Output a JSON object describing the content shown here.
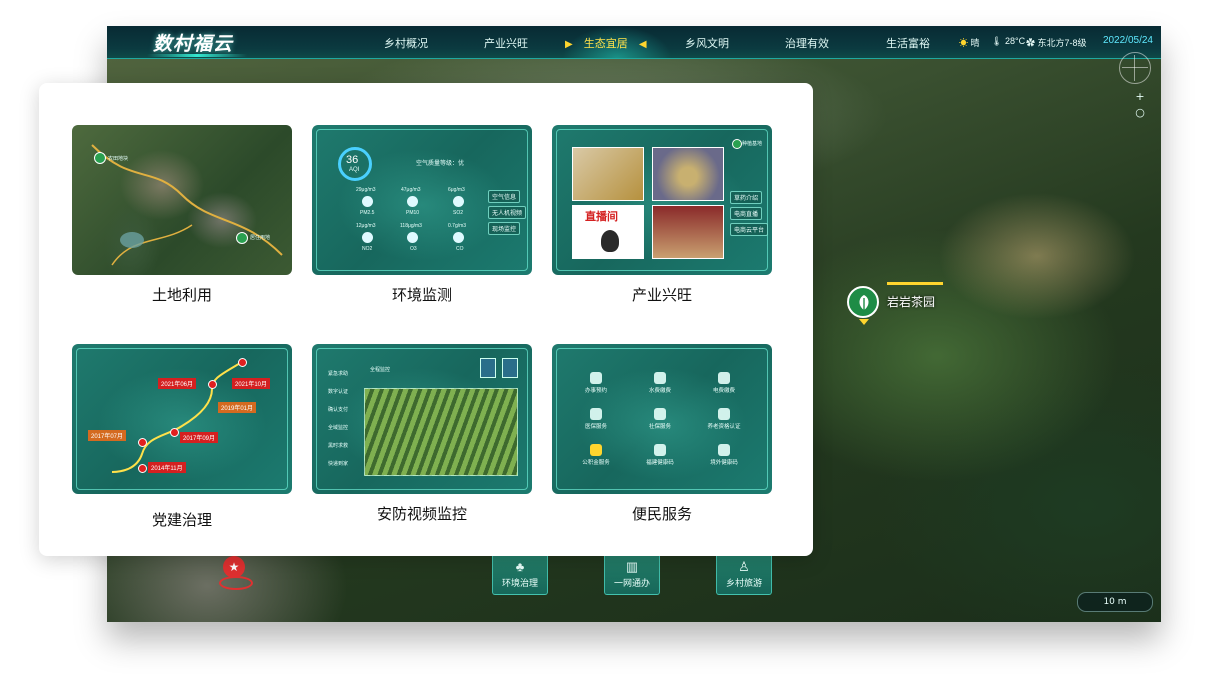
{
  "header": {
    "app_title": "数村福云",
    "tabs": [
      {
        "label": "乡村概况"
      },
      {
        "label": "产业兴旺"
      },
      {
        "label": "生态宜居",
        "active": true
      },
      {
        "label": "乡风文明"
      },
      {
        "label": "治理有效"
      },
      {
        "label": "生活富裕"
      }
    ],
    "active_markers": {
      "left": "▶",
      "right": "◀"
    },
    "weather": {
      "condition": "晴",
      "temperature": "28°C",
      "wind": "东北方7-8级"
    },
    "date": "2022/05/24"
  },
  "map": {
    "poi_label": "岩岩茶园",
    "scale_label": "10 m",
    "zoom_in": "+",
    "zoom_out": "○",
    "bottom_buttons": [
      {
        "label": "环境治理",
        "icon": "tree-icon"
      },
      {
        "label": "一网通办",
        "icon": "building-icon"
      },
      {
        "label": "乡村旅游",
        "icon": "person-icon"
      }
    ]
  },
  "overlay": {
    "cards": [
      {
        "label": "土地利用"
      },
      {
        "label": "环境监测"
      },
      {
        "label": "产业兴旺"
      },
      {
        "label": "党建治理"
      },
      {
        "label": "安防视频监控"
      },
      {
        "label": "便民服务"
      }
    ]
  },
  "thumb_land": {
    "tags": [
      "农田地块",
      "居住用地"
    ]
  },
  "thumb_env": {
    "aqi_value": "36",
    "aqi_unit": "AQI",
    "quality_text": "空气质量等级：优",
    "pollutants": [
      {
        "value": "29μg/m3",
        "name": "PM2.5"
      },
      {
        "value": "47μg/m3",
        "name": "PM10"
      },
      {
        "value": "6μg/m3",
        "name": "SO2"
      },
      {
        "value": "12μg/m3",
        "name": "NO2"
      },
      {
        "value": "118μg/m3",
        "name": "O3"
      },
      {
        "value": "0.7g/m3",
        "name": "CO"
      }
    ],
    "side_buttons": [
      "空气信息",
      "无人机视频",
      "现场监控"
    ]
  },
  "thumb_industry": {
    "live_text": "直播间",
    "side_buttons": [
      "草药介绍",
      "电商直播",
      "电商云平台"
    ],
    "corner_tag": "种植基地"
  },
  "thumb_party": {
    "events": [
      {
        "date": "2021年06月"
      },
      {
        "date": "2021年10月"
      },
      {
        "date": "2019年01月"
      },
      {
        "date": "2017年07月"
      },
      {
        "date": "2017年09月"
      },
      {
        "date": "2014年11月"
      }
    ]
  },
  "thumb_security": {
    "menu": [
      "紧急求助",
      "数字认证",
      "确认支付",
      "全域监控",
      "黑时求救",
      "快递到家"
    ],
    "caption": "全程监控"
  },
  "thumb_service": {
    "items": [
      "办事预约",
      "水费缴费",
      "电费缴费",
      "医保服务",
      "社保服务",
      "养老资格认证",
      "公积金服务",
      "福建健康码",
      "境外健康码"
    ]
  },
  "colors": {
    "accent": "#1fa9a0",
    "active_tab": "#ffe14a",
    "date": "#5fe9ff",
    "poi_green": "#1e8c46",
    "marker_red": "#e03030"
  }
}
